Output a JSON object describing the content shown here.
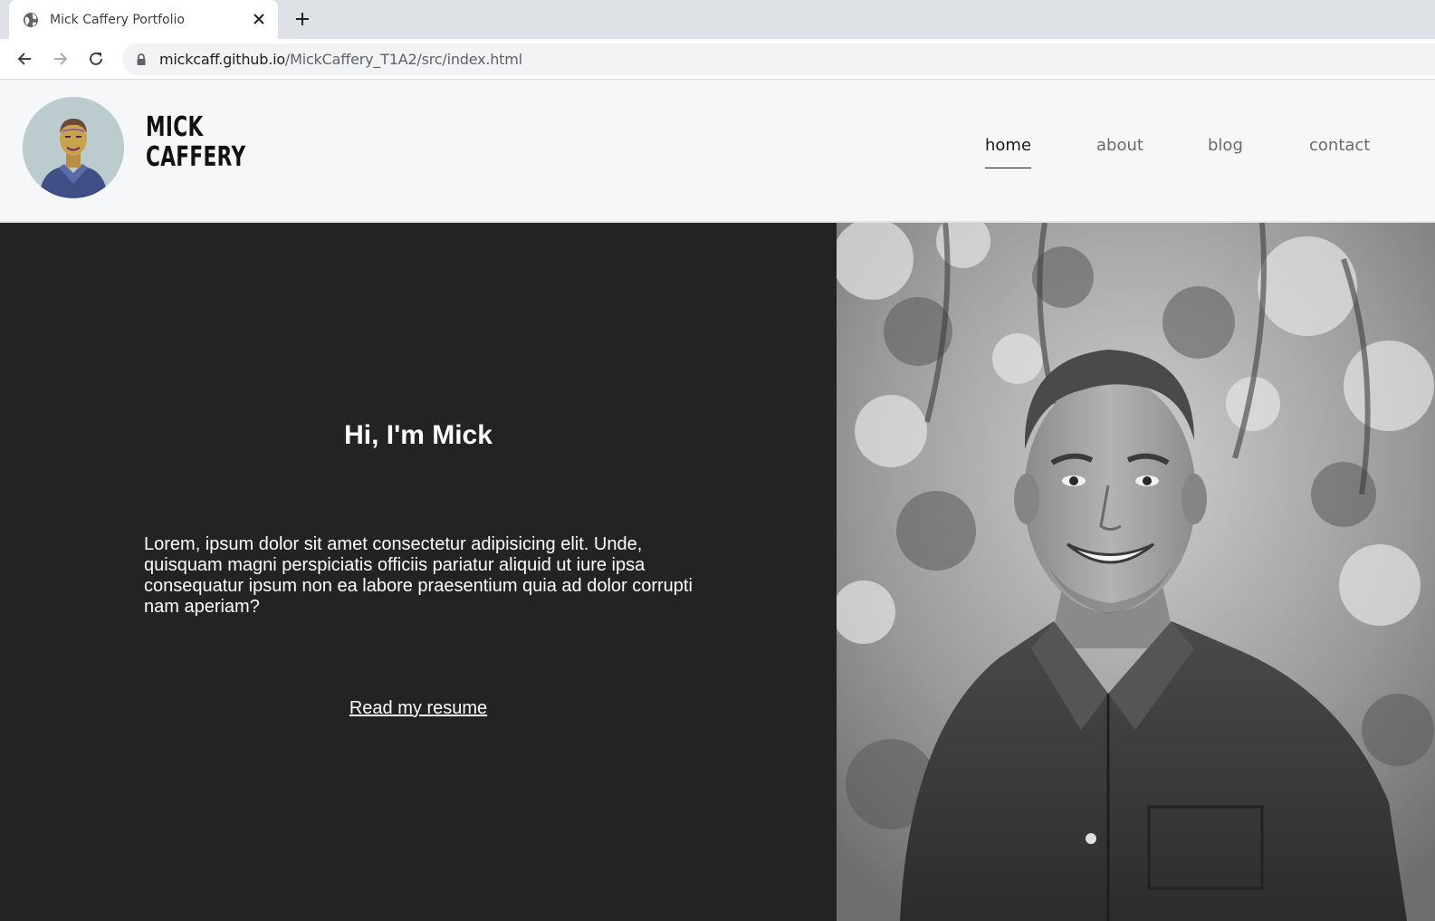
{
  "browser": {
    "tab_title": "Mick Caffery Portfolio",
    "url_host": "mickcaff.github.io",
    "url_path": "/MickCaffery_T1A2/src/index.html"
  },
  "header": {
    "name_line1": "MICK",
    "name_line2": "CAFFERY"
  },
  "nav": {
    "items": [
      {
        "label": "home",
        "active": true
      },
      {
        "label": "about",
        "active": false
      },
      {
        "label": "blog",
        "active": false
      },
      {
        "label": "contact",
        "active": false
      }
    ]
  },
  "hero": {
    "heading": "Hi, I'm Mick",
    "text": "Lorem, ipsum dolor sit amet consectetur adipisicing elit. Unde, quisquam magni perspiciatis officiis pariatur aliquid ut iure ipsa consequatur ipsum non ea labore praesentium quia ad dolor corrupti nam aperiam?",
    "link_label": "Read my resume"
  },
  "colors": {
    "hero_background": "#232326",
    "header_background": "#f6f7f9",
    "nav_inactive": "#6b6b6b",
    "nav_active": "#1a1a1a"
  }
}
